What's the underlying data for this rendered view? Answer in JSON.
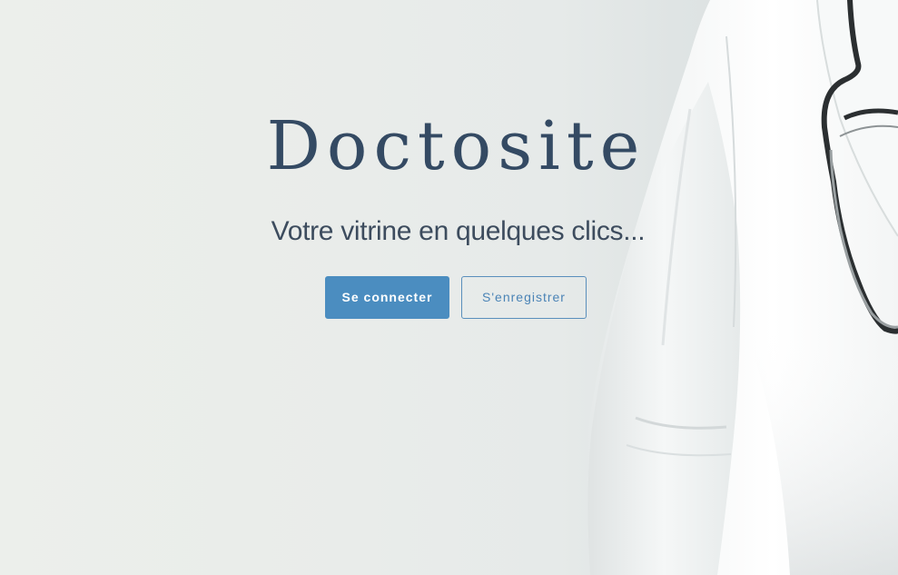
{
  "hero": {
    "title": "Doctosite",
    "tagline": "Votre vitrine en quelques clics...",
    "background_image": "doctor-white-coat-stethoscope"
  },
  "actions": {
    "login_label": "Se connecter",
    "register_label": "S'enregistrer"
  },
  "colors": {
    "title": "#344a63",
    "primary_button": "#4b8dc0",
    "outline_button_border": "#5a8fbc",
    "background": "#e9ecea"
  }
}
